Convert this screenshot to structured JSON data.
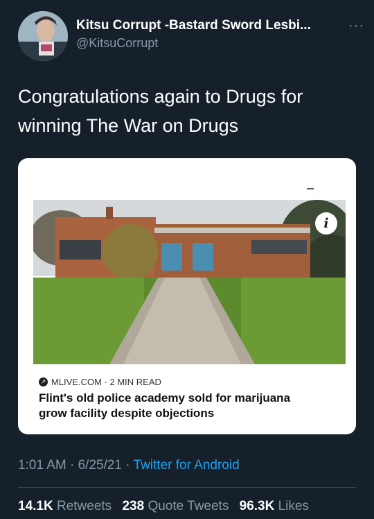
{
  "user": {
    "display_name": "Kitsu Corrupt -Bastard Sword Lesbi...",
    "handle": "@KitsuCorrupt"
  },
  "more_menu": "···",
  "tweet": {
    "text_line1": "Congratulations again to Drugs for",
    "text_line2": "winning The War on Drugs"
  },
  "card": {
    "info_icon": "i",
    "source": "MLIVE.COM · 2 MIN READ",
    "headline_line1": "Flint's old police academy sold for marijuana",
    "headline_line2": "grow facility despite objections"
  },
  "meta": {
    "time_date": "1:01 AM · 6/25/21 · ",
    "app": "Twitter for Android"
  },
  "stats": {
    "retweets_count": "14.1K",
    "retweets_label": "Retweets",
    "quotes_count": "238",
    "quotes_label": "Quote Tweets",
    "likes_count": "96.3K",
    "likes_label": "Likes"
  },
  "colors": {
    "background": "#15202b",
    "secondary_text": "#8899a6",
    "link": "#1da1f2"
  }
}
